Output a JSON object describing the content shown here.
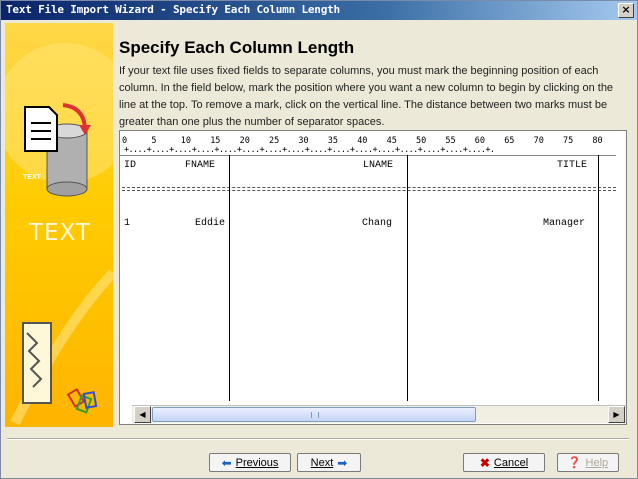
{
  "window": {
    "title": "Text File Import Wizard - Specify Each Column Length",
    "close_glyph": "×"
  },
  "sidebar": {
    "text": "TEXT",
    "icon_label": "TEXT",
    "icons": [
      "document-icon",
      "database-icon",
      "curved-arrow-icon",
      "chain-links-icon"
    ]
  },
  "main": {
    "heading": "Specify Each Column Length",
    "description": "If your text file uses fixed fields to separate columns, you must mark the beginning position of each column. In the field below, mark the position where you want a new column to begin by clicking on the line at the top. To remove a mark, click on the vertical line. The distance between two marks must be greater than one plus the number of separator spaces."
  },
  "ruler": {
    "numbers": [
      "0",
      "5",
      "10",
      "15",
      "20",
      "25",
      "30",
      "35",
      "40",
      "45",
      "50",
      "55",
      "60",
      "65",
      "70",
      "75",
      "80"
    ],
    "ticks": "+....+....+....+....+....+....+....+....+....+....+....+....+....+....+....+....+."
  },
  "grid": {
    "header": [
      "ID",
      "FNAME",
      "LNAME",
      "TITLE"
    ],
    "rows": [
      [
        "1",
        "Eddie",
        "Chang",
        "Manager"
      ]
    ],
    "separator": "================================================================================================"
  },
  "buttons": {
    "previous": "Previous",
    "next": "Next",
    "cancel": "Cancel",
    "help": "Help"
  },
  "colors": {
    "sidebar_yellow": "#ffcc00",
    "title_blue": "#0a246a",
    "cancel_red": "#cc0000"
  }
}
